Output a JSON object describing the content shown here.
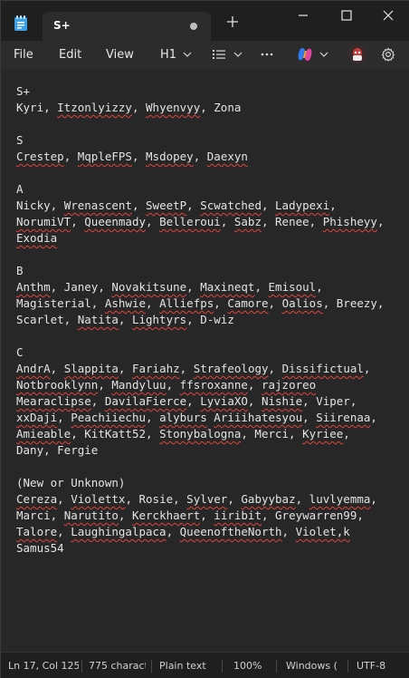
{
  "tab": {
    "title": "S+"
  },
  "menu": {
    "file": "File",
    "edit": "Edit",
    "view": "View",
    "heading": "H1"
  },
  "document": {
    "lines": [
      [
        "S+"
      ],
      [
        "Kyri, ",
        {
          "t": "Itzonlyizzy",
          "sq": true
        },
        ", ",
        {
          "t": "Whyenvyy",
          "sq": true
        },
        ", Zona"
      ],
      [
        ""
      ],
      [
        "S"
      ],
      [
        {
          "t": "Crestep",
          "sq": true
        },
        ", ",
        {
          "t": "MqpleFPS",
          "sq": true
        },
        ", ",
        {
          "t": "Msdopey",
          "sq": true
        },
        ", ",
        {
          "t": "Daexyn",
          "sq": true
        }
      ],
      [
        ""
      ],
      [
        "A"
      ],
      [
        "Nicky, ",
        {
          "t": "Wrenascent",
          "sq": true
        },
        ", ",
        {
          "t": "SweetP",
          "sq": true
        },
        ", ",
        {
          "t": "Scwatched",
          "sq": true
        },
        ", ",
        {
          "t": "Ladypexi",
          "sq": true
        },
        ","
      ],
      [
        {
          "t": "NorumiVT",
          "sq": true
        },
        ", ",
        {
          "t": "Queenmady",
          "sq": true
        },
        ", ",
        {
          "t": "Belleroui",
          "sq": true
        },
        ", ",
        {
          "t": "Sabz",
          "sq": true
        },
        ", Renee, ",
        {
          "t": "Phisheyy",
          "sq": true
        },
        ","
      ],
      [
        {
          "t": "Exodia",
          "sq": true
        }
      ],
      [
        ""
      ],
      [
        "B"
      ],
      [
        {
          "t": "Anthm",
          "sq": true
        },
        ", Janey, ",
        {
          "t": "Novakitsune",
          "sq": true
        },
        ", ",
        {
          "t": "Maxineqt",
          "sq": true
        },
        ", ",
        {
          "t": "Emisoul",
          "sq": true
        },
        ","
      ],
      [
        "Magisterial, ",
        {
          "t": "Ashwie",
          "sq": true
        },
        ", ",
        {
          "t": "Alliefps",
          "sq": true
        },
        ", ",
        {
          "t": "Camore",
          "sq": true
        },
        ", ",
        {
          "t": "Oalios",
          "sq": true
        },
        ", Breezy,"
      ],
      [
        "Scarlet, ",
        {
          "t": "Natita",
          "sq": true
        },
        ", ",
        {
          "t": "Lightyrs",
          "sq": true
        },
        ", D-wiz"
      ],
      [
        ""
      ],
      [
        "C"
      ],
      [
        {
          "t": "AndrA",
          "sq": true
        },
        ", ",
        {
          "t": "Slappita",
          "sq": true
        },
        ", ",
        {
          "t": "Fariahz",
          "sq": true
        },
        ", ",
        {
          "t": "Strafeology",
          "sq": true
        },
        ", ",
        {
          "t": "Dissifictual",
          "sq": true
        },
        ","
      ],
      [
        {
          "t": "Notbrooklynn",
          "sq": true
        },
        ", ",
        {
          "t": "Mandyluu",
          "sq": true
        },
        ", ",
        {
          "t": "ffsroxanne",
          "sq": true
        },
        ", ",
        {
          "t": "rajzoreo",
          "sq": true
        }
      ],
      [
        {
          "t": "Mearaclipse",
          "sq": true
        },
        ", ",
        {
          "t": "DavilaFierce",
          "sq": true
        },
        ", ",
        {
          "t": "LyviaXO",
          "sq": true
        },
        ", ",
        {
          "t": "Nishie",
          "sq": true
        },
        ", Viper,"
      ],
      [
        {
          "t": "xxDaji",
          "sq": true
        },
        ", ",
        {
          "t": "Peachiiechu",
          "sq": true
        },
        ", ",
        {
          "t": "alyburs",
          "sq": true
        },
        " ",
        {
          "t": "Ariiihatesyou",
          "sq": true
        },
        ", ",
        {
          "t": "Siirenaa",
          "sq": true
        },
        ","
      ],
      [
        {
          "t": "Amieable",
          "sq": true
        },
        ", KitKatt52, ",
        {
          "t": "Stonybalogna",
          "sq": true
        },
        ", Merci, ",
        {
          "t": "Kyriee",
          "sq": true
        },
        ","
      ],
      [
        "Dany, Fergie"
      ],
      [
        ""
      ],
      [
        "(New or Unknown)"
      ],
      [
        {
          "t": "Cereza",
          "sq": true
        },
        ", ",
        {
          "t": "Violettx",
          "sq": true
        },
        ", Rosie, ",
        {
          "t": "Sylver",
          "sq": true
        },
        ", ",
        {
          "t": "Gabyybaz",
          "sq": true
        },
        ", ",
        {
          "t": "luvlyemma",
          "sq": true
        },
        ","
      ],
      [
        "Marci, ",
        {
          "t": "Narutito",
          "sq": true
        },
        ", ",
        {
          "t": "Kerckhaert",
          "sq": true
        },
        ", ",
        {
          "t": "iiribit",
          "sq": true
        },
        ", Greywarren99,"
      ],
      [
        {
          "t": "Talore",
          "sq": true
        },
        ", ",
        {
          "t": "Laughingalpaca",
          "sq": true
        },
        ", ",
        {
          "t": "QueenoftheNorth",
          "sq": true
        },
        ", ",
        {
          "t": "Violet,k",
          "sq": true
        }
      ],
      [
        "Samus54"
      ]
    ]
  },
  "status": {
    "position": "Ln 17, Col 125",
    "chars": "775 charact",
    "format": "Plain text",
    "zoom": "100%",
    "line_ending": "Windows (",
    "encoding": "UTF-8"
  },
  "icons": {
    "app": "notepad-icon",
    "copilot": "copilot-icon",
    "avatar": "profile-avatar",
    "settings": "gear-icon"
  },
  "colors": {
    "background": "#272727",
    "titlebar": "#1f1f1f",
    "menubar": "#2c2c2c",
    "text": "#e4e4e4",
    "spellcheck_underline": "#e0443a",
    "app_icon": "#3aa0e8"
  }
}
